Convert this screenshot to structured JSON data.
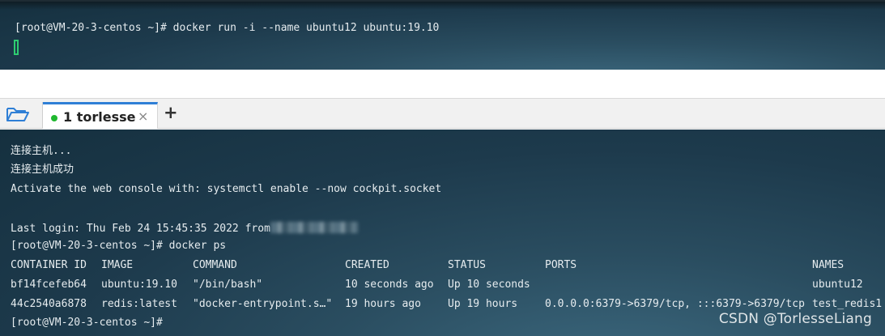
{
  "top_terminal": {
    "command_line": "[root@VM-20-3-centos ~]# docker run -i --name ubuntu12 ubuntu:19.10"
  },
  "tabbar": {
    "tab_label": "1 torlesse",
    "close_glyph": "×",
    "add_glyph": "+",
    "status_color": "#1fb82f",
    "icons": [
      "folder-open-icon",
      "close-icon",
      "plus-icon"
    ]
  },
  "terminal": {
    "line1": "连接主机...",
    "line2": "连接主机成功",
    "line3": "Activate the web console with: systemctl enable --now cockpit.socket",
    "last_login_prefix": "Last login: Thu Feb 24 15:45:35 2022 from",
    "prompt_ps": "[root@VM-20-3-centos ~]# docker ps",
    "ps_table": {
      "headers": [
        "CONTAINER ID",
        "IMAGE",
        "COMMAND",
        "CREATED",
        "STATUS",
        "PORTS",
        "NAMES"
      ],
      "rows": [
        [
          "bf14fcefeb64",
          "ubuntu:19.10",
          "\"/bin/bash\"",
          "10 seconds ago",
          "Up 10 seconds",
          "",
          "ubuntu12"
        ],
        [
          "44c2540a6878",
          "redis:latest",
          "\"docker-entrypoint.s…\"",
          "19 hours ago",
          "Up 19 hours",
          "0.0.0.0:6379->6379/tcp, :::6379->6379/tcp",
          "test_redis1"
        ]
      ]
    },
    "prompt_end": "[root@VM-20-3-centos ~]#"
  },
  "watermark": "CSDN @TorlesseLiang",
  "colors": {
    "cursor": "#2ecc71",
    "tab_accent": "#2f7fd6"
  }
}
